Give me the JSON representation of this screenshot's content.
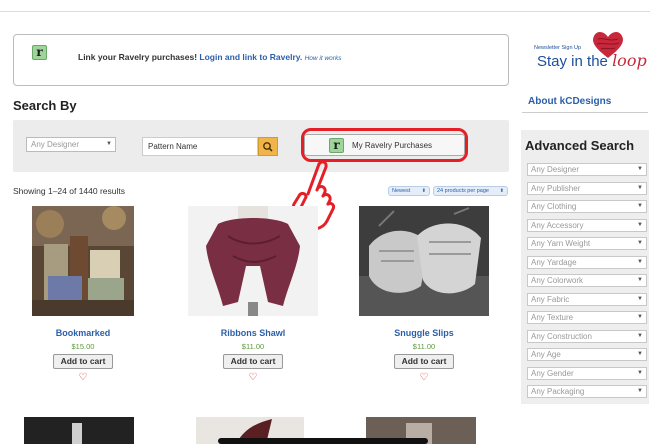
{
  "banner": {
    "logo_letter": "r",
    "text": "Link your Ravelry purchases!",
    "link": "Login and link to Ravelry.",
    "how": "How it works"
  },
  "newsletter": {
    "small": "Newsletter Sign Up",
    "main": "Stay in the",
    "loop": "loop"
  },
  "sidebar": {
    "about": "About kCDesigns",
    "advanced_title": "Advanced Search",
    "filters": [
      "Any Designer",
      "Any Publisher",
      "Any Clothing",
      "Any Accessory",
      "Any Yarn Weight",
      "Any Yardage",
      "Any Colorwork",
      "Any Fabric",
      "Any Texture",
      "Any Construction",
      "Any Age",
      "Any Gender",
      "Any Packaging"
    ]
  },
  "search": {
    "heading": "Search By",
    "designer_select": "Any Designer",
    "pattern_name": "Pattern Name",
    "ravelry_button": "My Ravelry Purchases",
    "ravelry_logo": "r"
  },
  "results": {
    "count_text": "Showing 1–24 of 1440 results",
    "sort": "Newest",
    "per_page": "24 products per page"
  },
  "products": [
    {
      "name": "Bookmarked",
      "price": "$15.00",
      "cart": "Add to cart"
    },
    {
      "name": "Ribbons Shawl",
      "price": "$11.00",
      "cart": "Add to cart"
    },
    {
      "name": "Snuggle Slips",
      "price": "$11.00",
      "cart": "Add to cart"
    }
  ],
  "colors": {
    "link": "#2b5faa",
    "price": "#5c9a3c",
    "highlight": "#e41f26",
    "search_button": "#f0b449"
  }
}
